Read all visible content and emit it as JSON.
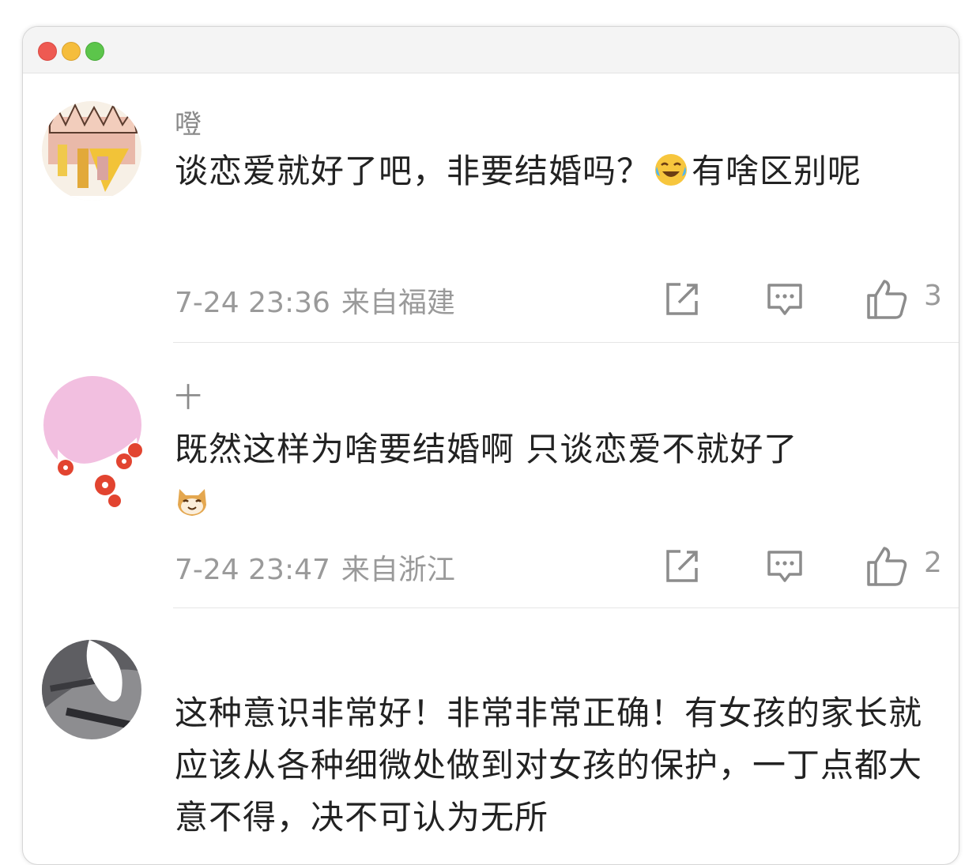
{
  "comments": [
    {
      "username": "噔",
      "text_a": "谈恋爱就好了吧，非要结婚吗？",
      "emoji": "laugh-cry-emoji",
      "text_b": "有啥区别呢",
      "time": "7-24 23:36",
      "location": "来自福建",
      "likes": "3"
    },
    {
      "username": "十",
      "text_a": "既然这样为啥要结婚啊 只谈恋爱不就好了",
      "emoji": "cat-emoji",
      "time": "7-24 23:47",
      "location": "来自浙江",
      "likes": "2"
    },
    {
      "username": "",
      "text": "这种意识非常好！非常非常正确！有女孩的家长就应该从各种细微处做到对女孩的保护，一丁点都大意不得，决不可认为无所"
    }
  ],
  "icons": {
    "share": "share-icon",
    "reply": "comment-icon",
    "like": "thumbs-up-icon"
  },
  "colors": {
    "text": "#222222",
    "meta": "#9a9a9a",
    "divider": "#e6e6e6"
  }
}
